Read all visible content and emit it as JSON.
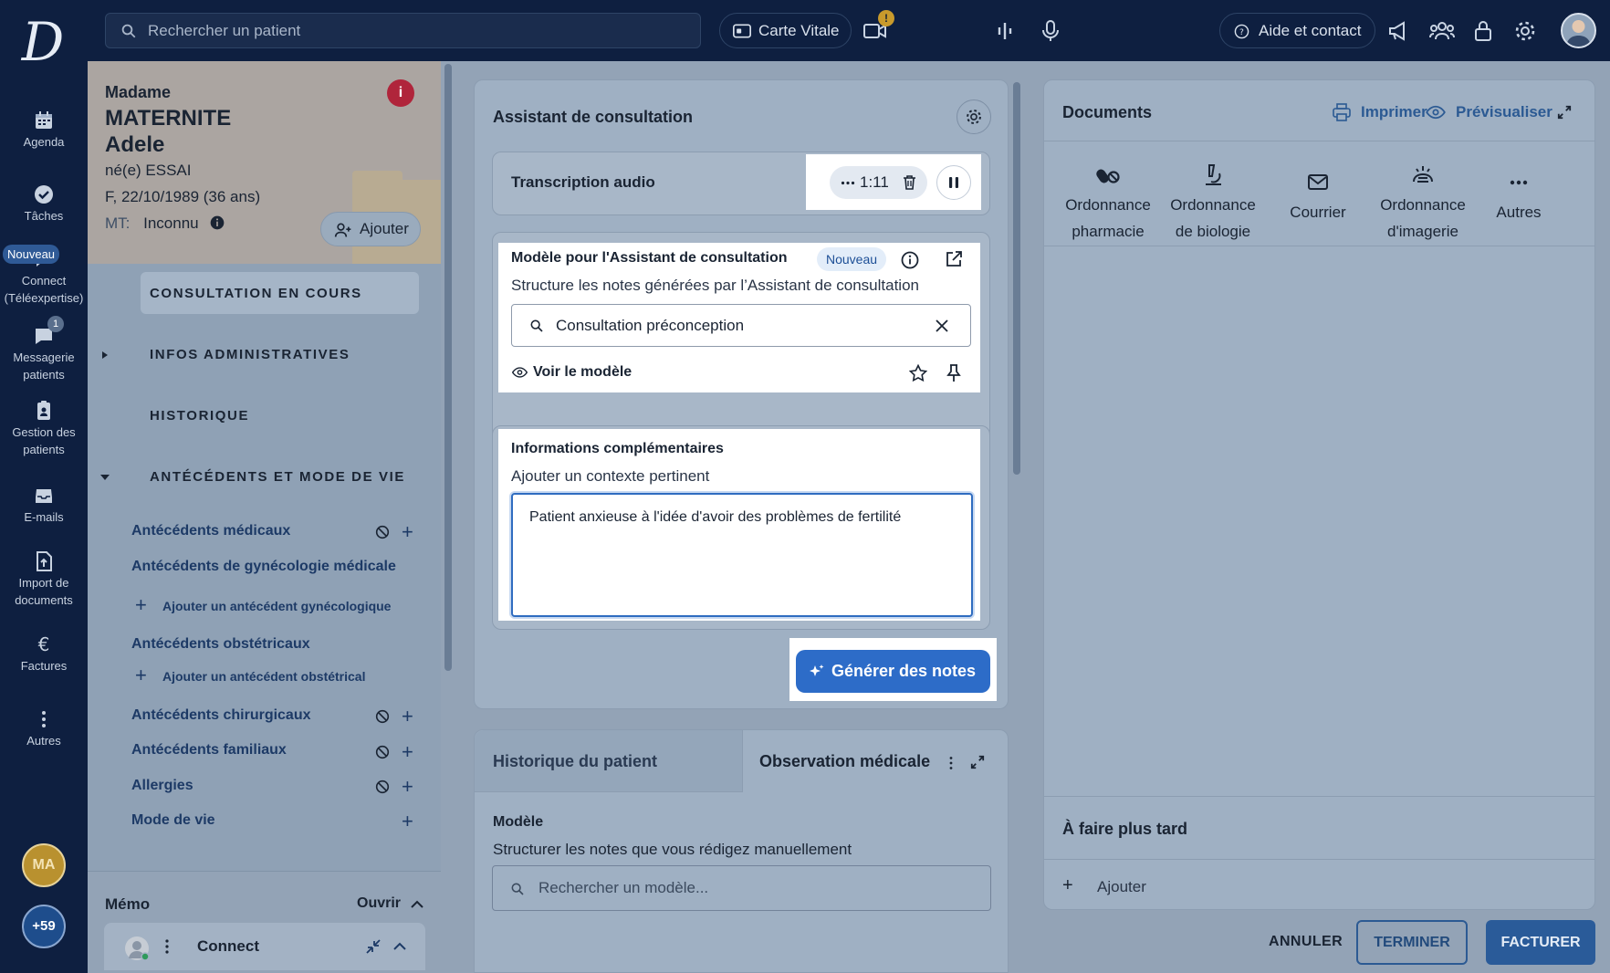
{
  "topbar": {
    "search_placeholder": "Rechercher un patient",
    "carte_vitale": "Carte Vitale",
    "video_alert": "!",
    "help": "Aide et contact"
  },
  "rail": {
    "agenda": "Agenda",
    "taches": "Tâches",
    "connect_badge": "Nouveau",
    "connect_line1": "Connect",
    "connect_line2": "(Téléexpertise)",
    "messagerie_count": "1",
    "messagerie_line1": "Messagerie",
    "messagerie_line2": "patients",
    "gestion_line1": "Gestion des",
    "gestion_line2": "patients",
    "emails": "E-mails",
    "import_line1": "Import de",
    "import_line2": "documents",
    "factures": "Factures",
    "autres": "Autres",
    "avatar_initials": "MA",
    "avatar_more": "+59"
  },
  "patient": {
    "civility": "Madame",
    "last_name": "MATERNITE",
    "first_name": "Adele",
    "birth_name": "né(e) ESSAI",
    "details": "F, 22/10/1989 (36 ans)",
    "mt_label": "MT:",
    "mt_value": "Inconnu",
    "add_button": "Ajouter",
    "sections": {
      "consultation": "CONSULTATION EN COURS",
      "infos": "INFOS ADMINISTRATIVES",
      "historique": "HISTORIQUE",
      "antecedents": "ANTÉCÉDENTS ET MODE DE VIE"
    },
    "items": {
      "medicaux": "Antécédents médicaux",
      "gyneco": "Antécédents de gynécologie médicale",
      "add_gyneco": "Ajouter un antécédent gynécologique",
      "obstetricaux": "Antécédents obstétricaux",
      "add_obstetrical": "Ajouter un antécédent obstétrical",
      "chirurgicaux": "Antécédents chirurgicaux",
      "familiaux": "Antécédents familiaux",
      "allergies": "Allergies",
      "mode_vie": "Mode de vie"
    },
    "memo": "Mémo",
    "memo_open": "Ouvrir",
    "connect": "Connect"
  },
  "assistant": {
    "title": "Assistant de consultation",
    "transcription": "Transcription audio",
    "timer": "1:11",
    "model_title": "Modèle pour l'Assistant de consultation",
    "model_badge": "Nouveau",
    "model_subtitle": "Structure les notes générées par l’Assistant de consultation",
    "model_value": "Consultation préconception",
    "view_model": "Voir le modèle",
    "info_title": "Informations complémentaires",
    "info_subtitle": "Ajouter un contexte pertinent",
    "info_value": "Patient anxieuse à l'idée d'avoir des problèmes de fertilité",
    "generate": "Générer des notes"
  },
  "observation": {
    "tab_history": "Historique du patient",
    "tab_obs": "Observation médicale",
    "model_label": "Modèle",
    "model_desc": "Structurer les notes que vous rédigez manuellement",
    "search_placeholder": "Rechercher un modèle..."
  },
  "documents": {
    "title": "Documents",
    "print": "Imprimer",
    "preview": "Prévisualiser",
    "types": [
      {
        "line1": "Ordonnance",
        "line2": "pharmacie"
      },
      {
        "line1": "Ordonnance",
        "line2": "de biologie"
      },
      {
        "line1": "Courrier",
        "line2": ""
      },
      {
        "line1": "Ordonnance",
        "line2": "d'imagerie"
      },
      {
        "line1": "Autres",
        "line2": ""
      }
    ],
    "later_title": "À faire plus tard",
    "later_add": "Ajouter"
  },
  "actions": {
    "cancel": "ANNULER",
    "finish": "TERMINER",
    "bill": "FACTURER"
  },
  "colors": {
    "rail_bg": "#0e1f40",
    "accent_blue": "#2d6cc8",
    "alert_red": "#b0253b",
    "dimmed_bg": "#9fb0c3"
  }
}
